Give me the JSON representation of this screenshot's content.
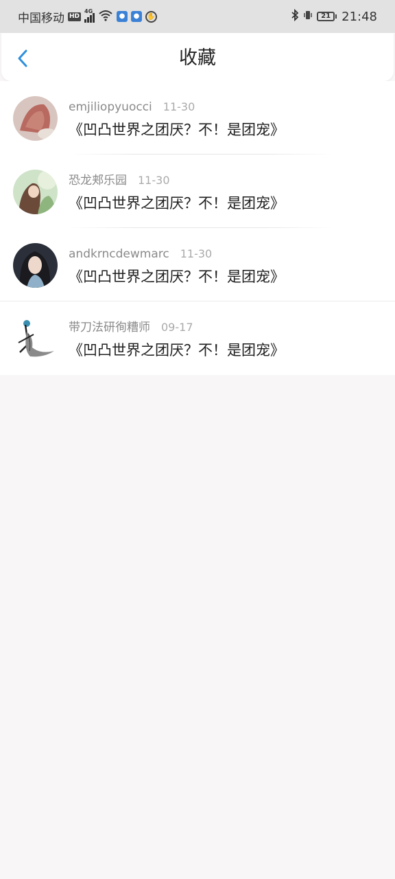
{
  "status_bar": {
    "carrier": "中国移动",
    "hd": "HD",
    "network": "4G",
    "battery": "21",
    "time": "21:48"
  },
  "header": {
    "title": "收藏",
    "back_icon": "chevron-left-icon",
    "accent_color": "#2d8fdc"
  },
  "favorites": [
    {
      "username": "emjiliopyuocci",
      "date": "11-30",
      "title": "《凹凸世界之团厌？不！是团宠》"
    },
    {
      "username": "恐龙郏乐园",
      "date": "11-30",
      "title": "《凹凸世界之团厌？不！是团宠》"
    },
    {
      "username": "andkrncdewmarc",
      "date": "11-30",
      "title": "《凹凸世界之团厌？不！是团宠》"
    },
    {
      "username": "带刀法研徇糟师",
      "date": "09-17",
      "title": "《凹凸世界之团厌？不！是团宠》"
    }
  ]
}
